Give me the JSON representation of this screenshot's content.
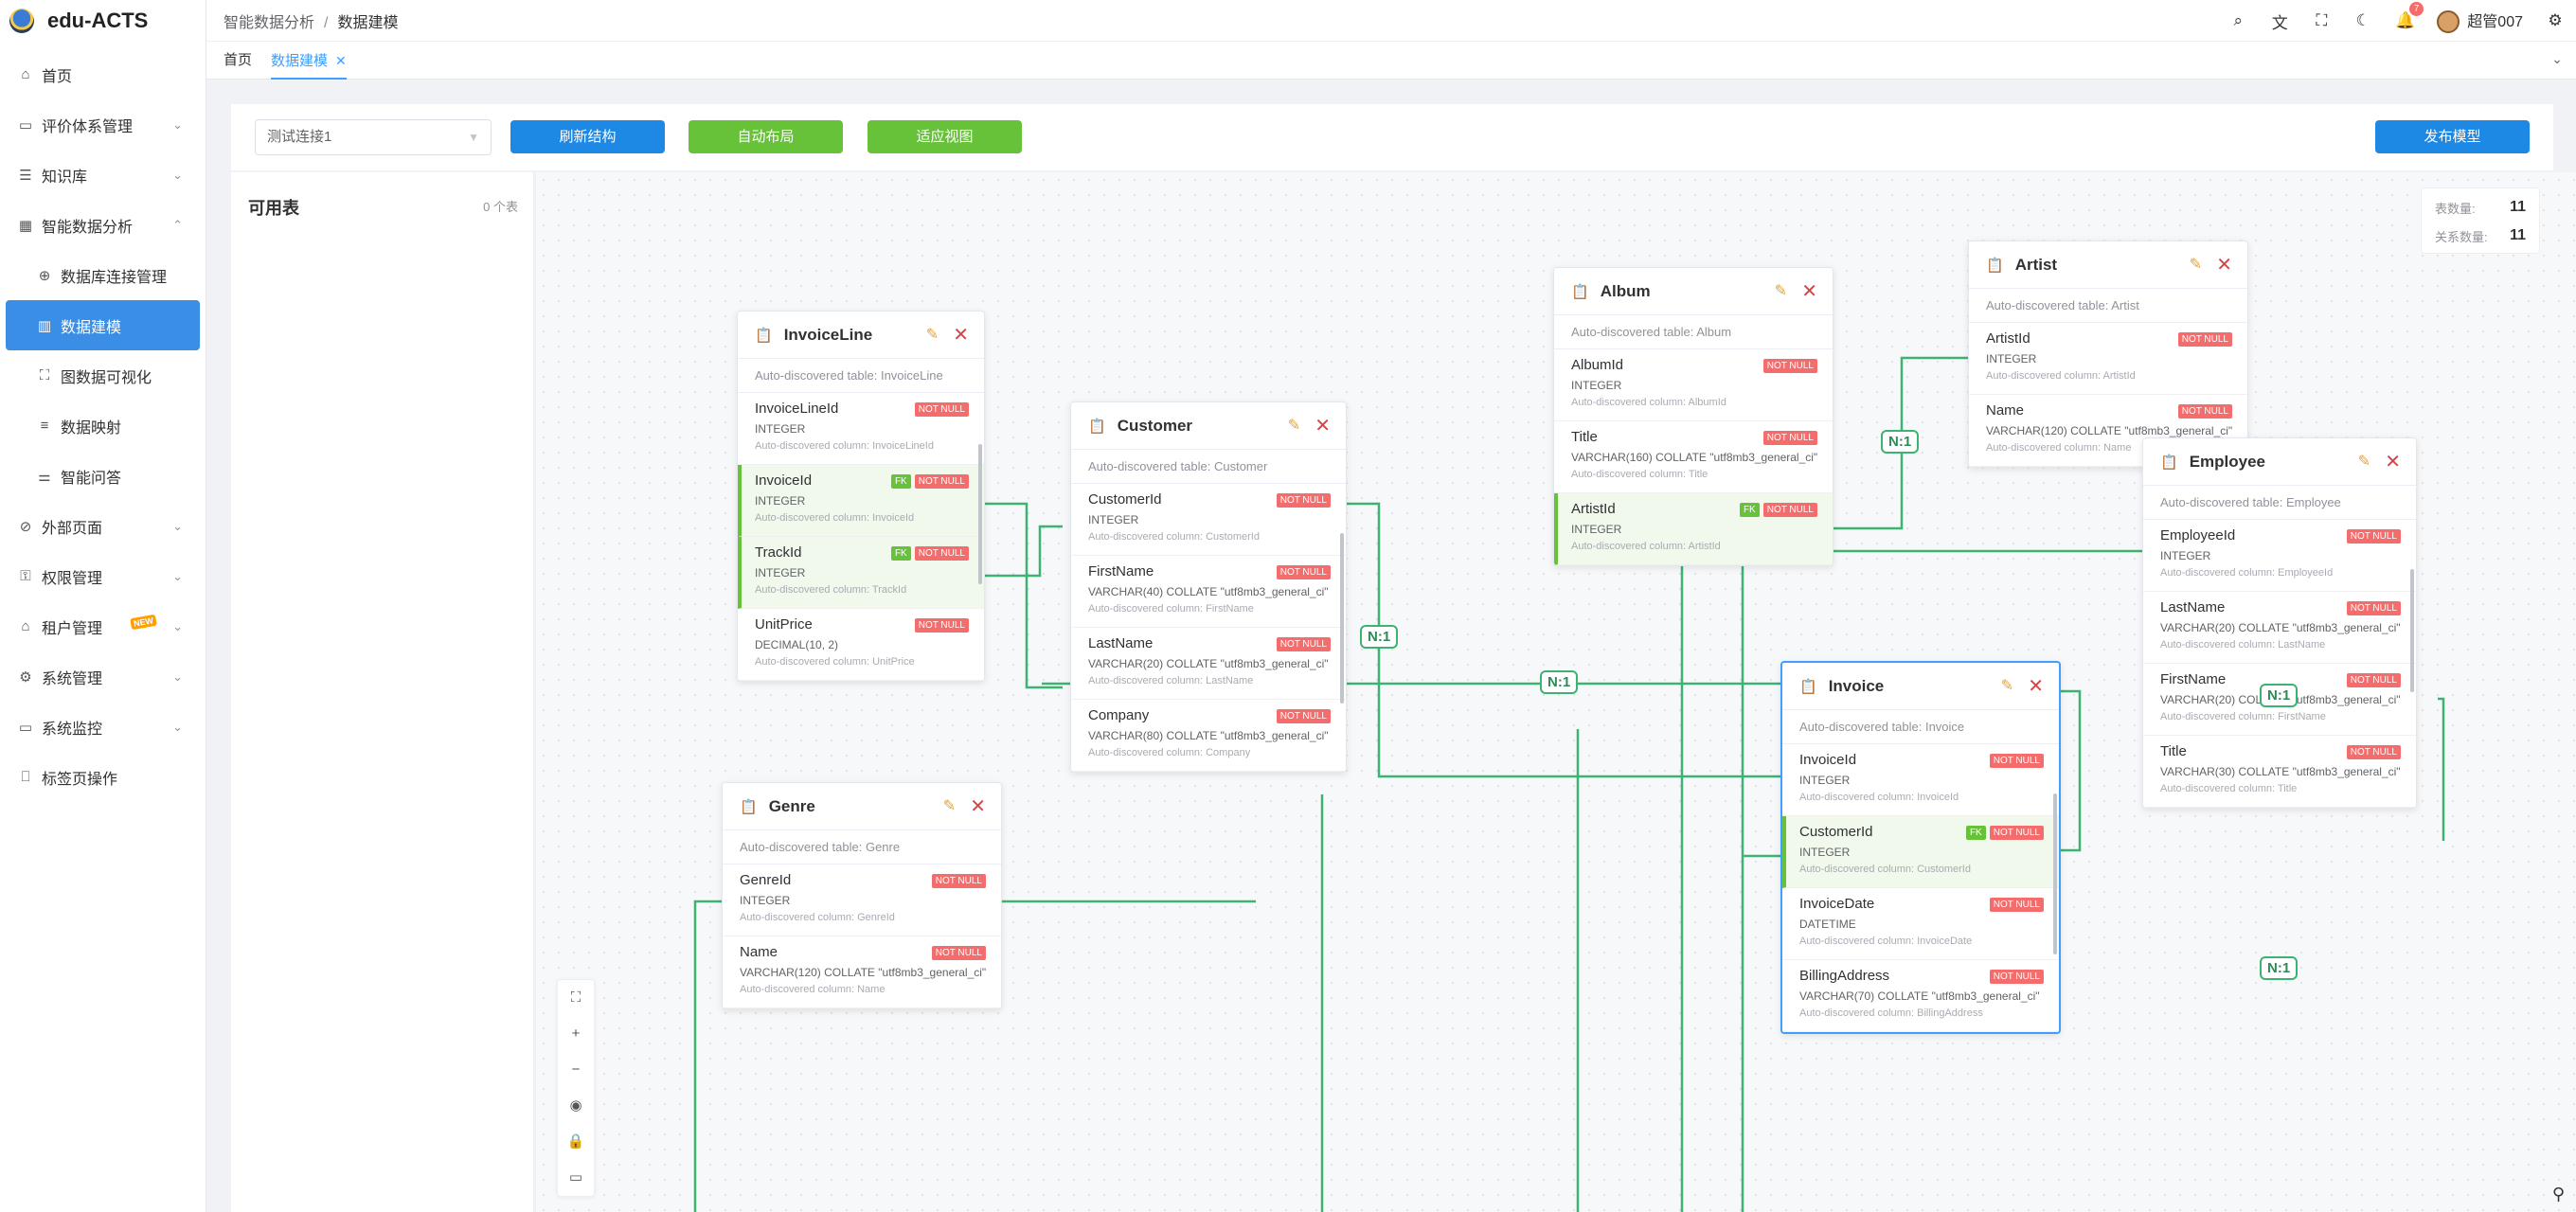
{
  "app": {
    "name": "edu-ACTS"
  },
  "sidebar": {
    "items": [
      {
        "label": "首页",
        "icon": "home-icon",
        "glyph": "⌂",
        "chev": ""
      },
      {
        "label": "评价体系管理",
        "icon": "monitor-icon",
        "glyph": "▭",
        "chev": "⌄"
      },
      {
        "label": "知识库",
        "icon": "database-icon",
        "glyph": "☰",
        "chev": "⌄"
      },
      {
        "label": "智能数据分析",
        "icon": "analytics-icon",
        "glyph": "▦",
        "chev": "⌃"
      },
      {
        "label": "数据库连接管理",
        "icon": "link-icon",
        "glyph": "⊕",
        "chev": "",
        "sub": true
      },
      {
        "label": "数据建模",
        "icon": "model-icon",
        "glyph": "▥",
        "chev": "",
        "sub": true,
        "active": true
      },
      {
        "label": "图数据可视化",
        "icon": "graph-icon",
        "glyph": "⛶",
        "chev": "",
        "sub": true
      },
      {
        "label": "数据映射",
        "icon": "list-icon",
        "glyph": "≡",
        "chev": "",
        "sub": true
      },
      {
        "label": "智能问答",
        "icon": "sliders-icon",
        "glyph": "⚌",
        "chev": "",
        "sub": true
      },
      {
        "label": "外部页面",
        "icon": "external-link-icon",
        "glyph": "⊘",
        "chev": "⌄"
      },
      {
        "label": "权限管理",
        "icon": "key-icon",
        "glyph": "⚿",
        "chev": "⌄"
      },
      {
        "label": "租户管理",
        "icon": "building-icon",
        "glyph": "⌂",
        "chev": "⌄",
        "badge": "NEW"
      },
      {
        "label": "系统管理",
        "icon": "gear-icon",
        "glyph": "⚙",
        "chev": "⌄"
      },
      {
        "label": "系统监控",
        "icon": "screen-icon",
        "glyph": "▭",
        "chev": "⌄"
      },
      {
        "label": "标签页操作",
        "icon": "bookmark-icon",
        "glyph": "⎕",
        "chev": ""
      }
    ]
  },
  "header": {
    "breadcrumb": [
      "智能数据分析",
      "数据建模"
    ],
    "sep": "/",
    "user": "超管007",
    "notif_count": "7"
  },
  "tabs": [
    {
      "label": "首页"
    },
    {
      "label": "数据建模",
      "close": "✕"
    }
  ],
  "toolbar": {
    "connection": "测试连接1",
    "refresh": "刷新结构",
    "auto_layout": "自动布局",
    "fit_view": "适应视图",
    "publish": "发布模型"
  },
  "left_panel": {
    "title": "可用表",
    "count": "0 个表"
  },
  "stats": {
    "tables_label": "表数量:",
    "tables": "11",
    "rels_label": "关系数量:",
    "rels": "11"
  },
  "relation_label": "N:1",
  "tables": [
    {
      "name": "InvoiceLine",
      "desc": "Auto-discovered table: InvoiceLine",
      "columns": [
        {
          "name": "InvoiceLineId",
          "type": "INTEGER",
          "desc": "Auto-discovered column: InvoiceLineId",
          "fk": false
        },
        {
          "name": "InvoiceId",
          "type": "INTEGER",
          "desc": "Auto-discovered column: InvoiceId",
          "fk": true
        },
        {
          "name": "TrackId",
          "type": "INTEGER",
          "desc": "Auto-discovered column: TrackId",
          "fk": true
        },
        {
          "name": "UnitPrice",
          "type": "DECIMAL(10, 2)",
          "desc": "Auto-discovered column: UnitPrice",
          "fk": false
        }
      ]
    },
    {
      "name": "Customer",
      "desc": "Auto-discovered table: Customer",
      "columns": [
        {
          "name": "CustomerId",
          "type": "INTEGER",
          "desc": "Auto-discovered column: CustomerId",
          "fk": false
        },
        {
          "name": "FirstName",
          "type": "VARCHAR(40) COLLATE \"utf8mb3_general_ci\"",
          "desc": "Auto-discovered column: FirstName",
          "fk": false
        },
        {
          "name": "LastName",
          "type": "VARCHAR(20) COLLATE \"utf8mb3_general_ci\"",
          "desc": "Auto-discovered column: LastName",
          "fk": false
        },
        {
          "name": "Company",
          "type": "VARCHAR(80) COLLATE \"utf8mb3_general_ci\"",
          "desc": "Auto-discovered column: Company",
          "fk": false
        }
      ]
    },
    {
      "name": "Album",
      "desc": "Auto-discovered table: Album",
      "columns": [
        {
          "name": "AlbumId",
          "type": "INTEGER",
          "desc": "Auto-discovered column: AlbumId",
          "fk": false
        },
        {
          "name": "Title",
          "type": "VARCHAR(160) COLLATE \"utf8mb3_general_ci\"",
          "desc": "Auto-discovered column: Title",
          "fk": false
        },
        {
          "name": "ArtistId",
          "type": "INTEGER",
          "desc": "Auto-discovered column: ArtistId",
          "fk": true
        }
      ]
    },
    {
      "name": "Artist",
      "desc": "Auto-discovered table: Artist",
      "columns": [
        {
          "name": "ArtistId",
          "type": "INTEGER",
          "desc": "Auto-discovered column: ArtistId",
          "fk": false
        },
        {
          "name": "Name",
          "type": "VARCHAR(120) COLLATE \"utf8mb3_general_ci\"",
          "desc": "Auto-discovered column: Name",
          "fk": false
        }
      ]
    },
    {
      "name": "Employee",
      "desc": "Auto-discovered table: Employee",
      "columns": [
        {
          "name": "EmployeeId",
          "type": "INTEGER",
          "desc": "Auto-discovered column: EmployeeId",
          "fk": false
        },
        {
          "name": "LastName",
          "type": "VARCHAR(20) COLLATE \"utf8mb3_general_ci\"",
          "desc": "Auto-discovered column: LastName",
          "fk": false
        },
        {
          "name": "FirstName",
          "type": "VARCHAR(20) COLLATE \"utf8mb3_general_ci\"",
          "desc": "Auto-discovered column: FirstName",
          "fk": false
        },
        {
          "name": "Title",
          "type": "VARCHAR(30) COLLATE \"utf8mb3_general_ci\"",
          "desc": "Auto-discovered column: Title",
          "fk": false
        }
      ]
    },
    {
      "name": "Invoice",
      "desc": "Auto-discovered table: Invoice",
      "columns": [
        {
          "name": "InvoiceId",
          "type": "INTEGER",
          "desc": "Auto-discovered column: InvoiceId",
          "fk": false
        },
        {
          "name": "CustomerId",
          "type": "INTEGER",
          "desc": "Auto-discovered column: CustomerId",
          "fk": true
        },
        {
          "name": "InvoiceDate",
          "type": "DATETIME",
          "desc": "Auto-discovered column: InvoiceDate",
          "fk": false
        },
        {
          "name": "BillingAddress",
          "type": "VARCHAR(70) COLLATE \"utf8mb3_general_ci\"",
          "desc": "Auto-discovered column: BillingAddress",
          "fk": false
        }
      ]
    },
    {
      "name": "Genre",
      "desc": "Auto-discovered table: Genre",
      "columns": [
        {
          "name": "GenreId",
          "type": "INTEGER",
          "desc": "Auto-discovered column: GenreId",
          "fk": false
        },
        {
          "name": "Name",
          "type": "VARCHAR(120) COLLATE \"utf8mb3_general_ci\"",
          "desc": "Auto-discovered column: Name",
          "fk": false
        }
      ]
    }
  ],
  "tag_labels": {
    "not_null": "NOT NULL",
    "fk": "FK"
  },
  "colors": {
    "primary": "#1e88e5",
    "success": "#67c23a",
    "danger": "#f56c6c",
    "edge": "#3cb371"
  },
  "zoom_controls": [
    {
      "icon": "fit-screen-icon",
      "glyph": "⛶"
    },
    {
      "icon": "zoom-in-icon",
      "glyph": "+"
    },
    {
      "icon": "zoom-out-icon",
      "glyph": "−"
    },
    {
      "icon": "center-icon",
      "glyph": "◉"
    },
    {
      "icon": "lock-icon",
      "glyph": "🔒"
    },
    {
      "icon": "minimap-icon",
      "glyph": "▭"
    }
  ]
}
